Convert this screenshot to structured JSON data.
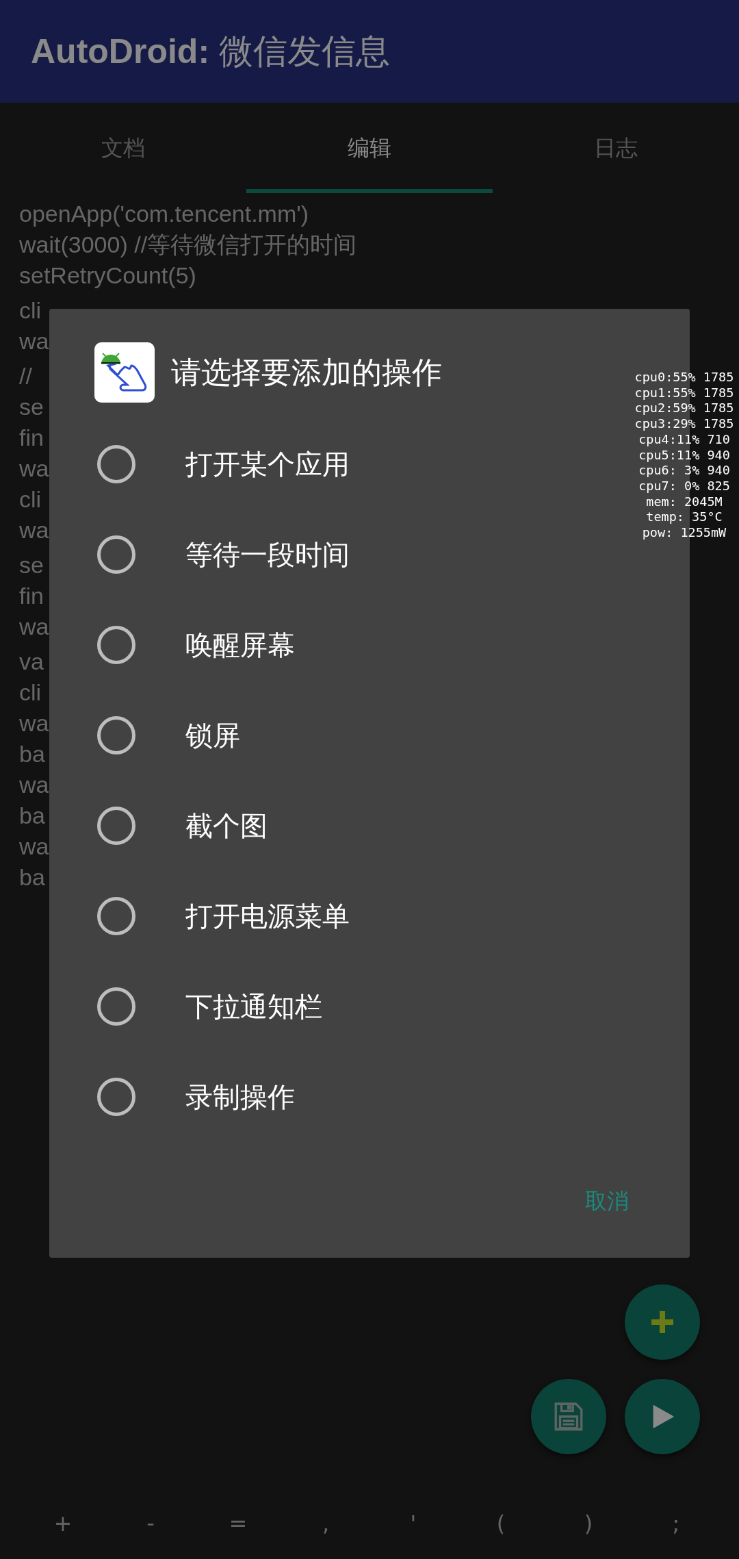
{
  "app_bar": {
    "title": "**AutoDroid:** 微信发信息"
  },
  "tabs": [
    {
      "label": "文档",
      "selected": false
    },
    {
      "label": "编辑",
      "selected": true
    },
    {
      "label": "日志",
      "selected": false
    }
  ],
  "editor": {
    "lines": [
      "openApp('com.tencent.mm')",
      "wait(3000) //等待微信打开的时间",
      "setRetryCount(5)",
      "cli",
      "wa",
      "//",
      "se",
      "fin",
      "wa",
      "cli",
      "wa",
      "se",
      "fin",
      "wa",
      "va",
      "cli",
      "wa",
      "ba",
      "wa",
      "ba",
      "wa",
      "ba"
    ]
  },
  "fabs": [
    {
      "kind": "add"
    },
    {
      "kind": "save"
    },
    {
      "kind": "run"
    }
  ],
  "symbol_bar": {
    "keys": [
      "+",
      "-",
      "=",
      ",",
      "'",
      "(",
      ")",
      ";"
    ]
  },
  "dialog": {
    "title": "请选择要添加的操作",
    "options": [
      {
        "label": "打开某个应用",
        "selected": false
      },
      {
        "label": "等待一段时间",
        "selected": false
      },
      {
        "label": "唤醒屏幕",
        "selected": false
      },
      {
        "label": "锁屏",
        "selected": false
      },
      {
        "label": "截个图",
        "selected": false
      },
      {
        "label": "打开电源菜单",
        "selected": false
      },
      {
        "label": "下拉通知栏",
        "selected": false
      },
      {
        "label": "录制操作",
        "selected": false
      }
    ],
    "buttons": [
      "取消"
    ]
  },
  "perf_overlay": {
    "lines": [
      "cpu0:55% 1785",
      "cpu1:55% 1785",
      "cpu2:59% 1785",
      "cpu3:29% 1785",
      "cpu4:11% 710",
      "cpu5:11% 940",
      "cpu6: 3% 940",
      "cpu7: 0% 825",
      "mem: 2045M",
      "temp: 35°C",
      "pow: 1255mW"
    ]
  }
}
